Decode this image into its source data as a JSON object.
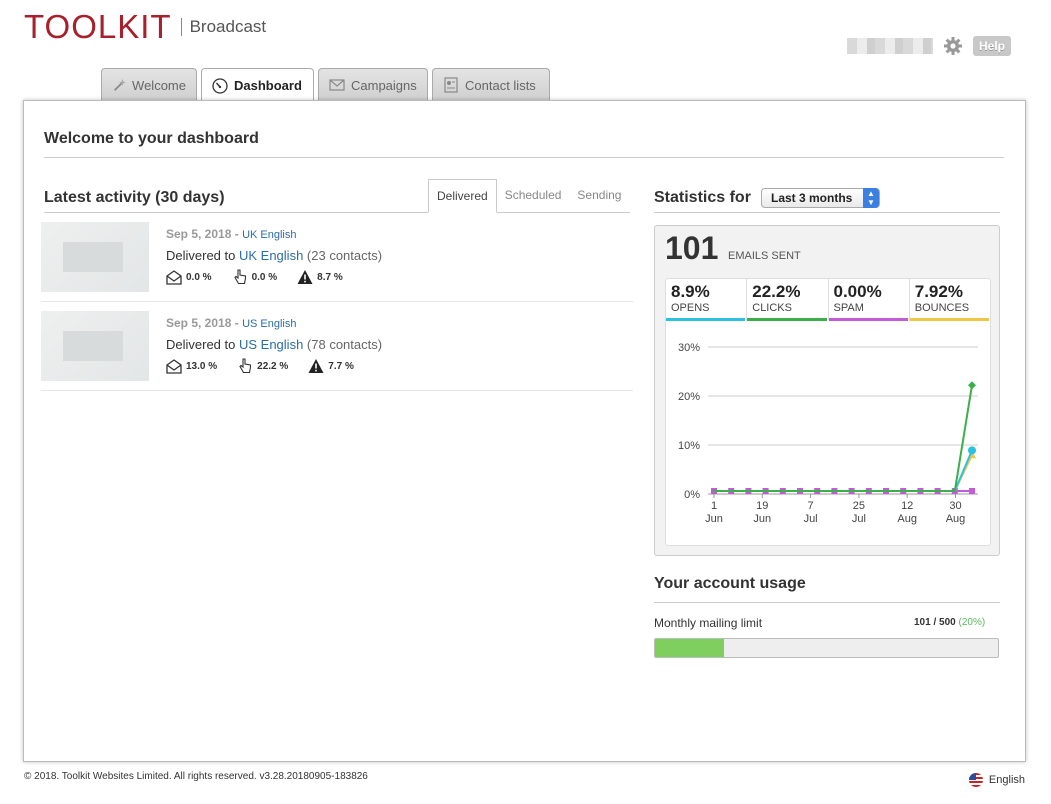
{
  "header": {
    "logo": "TOOLKIT",
    "product": "Broadcast",
    "help_label": "Help"
  },
  "tabs": [
    {
      "label": "Welcome",
      "icon": "wand-icon"
    },
    {
      "label": "Dashboard",
      "icon": "gauge-icon",
      "active": true
    },
    {
      "label": "Campaigns",
      "icon": "envelope-icon"
    },
    {
      "label": "Contact lists",
      "icon": "contact-card-icon"
    }
  ],
  "page": {
    "title": "Welcome to your dashboard"
  },
  "activity": {
    "title": "Latest activity (30 days)",
    "tabs": [
      "Delivered",
      "Scheduled",
      "Sending"
    ],
    "active_tab": "Delivered",
    "items": [
      {
        "date": "Sep 5, 2018",
        "sep": " - ",
        "list": "UK English",
        "delivered_prefix": "Delivered to ",
        "list_link": "UK English",
        "contacts": "(23 contacts)",
        "opens": "0.0 %",
        "clicks": "0.0 %",
        "bounces": "8.7 %"
      },
      {
        "date": "Sep 5, 2018",
        "sep": " - ",
        "list": "US English",
        "delivered_prefix": "Delivered to ",
        "list_link": "US English",
        "contacts": "(78 contacts)",
        "opens": "13.0 %",
        "clicks": "22.2 %",
        "bounces": "7.7 %"
      }
    ]
  },
  "stats": {
    "title": "Statistics for",
    "range": "Last 3 months",
    "emails_sent": "101",
    "emails_sent_label": "EMAILS SENT",
    "kpis": [
      {
        "value": "8.9%",
        "label": "OPENS",
        "color": "#2bc1e0"
      },
      {
        "value": "22.2%",
        "label": "CLICKS",
        "color": "#3bb04a"
      },
      {
        "value": "0.00%",
        "label": "SPAM",
        "color": "#c25bd6"
      },
      {
        "value": "7.92%",
        "label": "BOUNCES",
        "color": "#efc744"
      }
    ]
  },
  "chart_data": {
    "type": "line",
    "x": [
      "1 Jun",
      "19 Jun",
      "7 Jul",
      "25 Jul",
      "12 Aug",
      "30 Aug"
    ],
    "xticks": [
      {
        "day": "1",
        "month": "Jun"
      },
      {
        "day": "19",
        "month": "Jun"
      },
      {
        "day": "7",
        "month": "Jul"
      },
      {
        "day": "25",
        "month": "Jul"
      },
      {
        "day": "12",
        "month": "Aug"
      },
      {
        "day": "30",
        "month": "Aug"
      }
    ],
    "yticks": [
      "0%",
      "10%",
      "20%",
      "30%"
    ],
    "ylim": [
      0,
      30
    ],
    "points_per_series": 16,
    "series": [
      {
        "key": "opens",
        "color": "#2bc1e0",
        "values": [
          0,
          0,
          0,
          0,
          0,
          0,
          0,
          0,
          0,
          0,
          0,
          0,
          0,
          0,
          0,
          8.9
        ]
      },
      {
        "key": "clicks",
        "color": "#3bb04a",
        "values": [
          0,
          0,
          0,
          0,
          0,
          0,
          0,
          0,
          0,
          0,
          0,
          0,
          0,
          0,
          0,
          22.2
        ]
      },
      {
        "key": "spam",
        "color": "#c25bd6",
        "values": [
          0,
          0,
          0,
          0,
          0,
          0,
          0,
          0,
          0,
          0,
          0,
          0,
          0,
          0,
          0,
          0
        ]
      },
      {
        "key": "bounces",
        "color": "#efc744",
        "values": [
          0,
          0,
          0,
          0,
          0,
          0,
          0,
          0,
          0,
          0,
          0,
          0,
          0,
          0,
          0,
          7.92
        ]
      }
    ],
    "grid": true
  },
  "usage": {
    "title": "Your account usage",
    "label": "Monthly mailing limit",
    "value": "101 / 500",
    "percent": "(20%)",
    "fraction": 0.2
  },
  "footer": {
    "copyright": "© 2018. Toolkit Websites Limited. All rights reserved. v3.28.20180905-183826",
    "language": "English"
  }
}
